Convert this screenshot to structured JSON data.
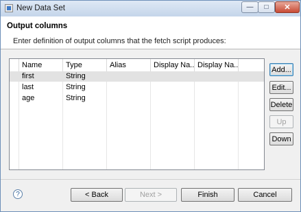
{
  "window": {
    "title": "New Data Set"
  },
  "header": {
    "title": "Output columns",
    "description": "Enter definition of output columns that the fetch script produces:"
  },
  "table": {
    "columns": [
      "Name",
      "Type",
      "Alias",
      "Display Na...",
      "Display Na..."
    ],
    "rows": [
      {
        "name": "first",
        "type": "String",
        "alias": "",
        "display_name": "",
        "display_name_key": ""
      },
      {
        "name": "last",
        "type": "String",
        "alias": "",
        "display_name": "",
        "display_name_key": ""
      },
      {
        "name": "age",
        "type": "String",
        "alias": "",
        "display_name": "",
        "display_name_key": ""
      }
    ],
    "selected_row": 0
  },
  "side_buttons": {
    "add": "Add...",
    "edit": "Edit...",
    "delete": "Delete",
    "up": "Up",
    "down": "Down"
  },
  "footer": {
    "back": "< Back",
    "next": "Next >",
    "finish": "Finish",
    "cancel": "Cancel",
    "help": "?"
  }
}
